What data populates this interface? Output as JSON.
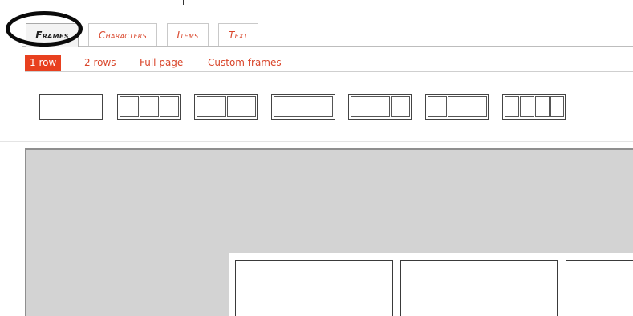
{
  "tabs": [
    {
      "label": "Frames",
      "active": true
    },
    {
      "label": "Characters",
      "active": false
    },
    {
      "label": "Items",
      "active": false
    },
    {
      "label": "Text",
      "active": false
    }
  ],
  "subnav": [
    {
      "label": "1 row",
      "active": true
    },
    {
      "label": "2 rows",
      "active": false
    },
    {
      "label": "Full page",
      "active": false
    },
    {
      "label": "Custom frames",
      "active": false
    }
  ],
  "layouts": [
    {
      "name": "single-panel",
      "panels": 1
    },
    {
      "name": "three-equal",
      "panels": 3
    },
    {
      "name": "two-equal",
      "panels": 2
    },
    {
      "name": "single-wide",
      "panels": 1
    },
    {
      "name": "wide-then-narrow",
      "panels": 2
    },
    {
      "name": "narrow-then-wide",
      "panels": 2
    },
    {
      "name": "four-equal",
      "panels": 4
    }
  ],
  "canvas": {
    "frames_visible": 3
  },
  "colors": {
    "accent": "#e8401f",
    "tab_text": "#d9452a",
    "canvas_bg": "#d3d3d3",
    "highlight_circle": "#0a0a0a"
  }
}
